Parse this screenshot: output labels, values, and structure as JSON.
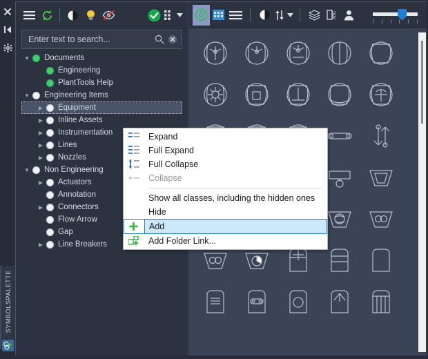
{
  "rail": {
    "icons": [
      {
        "name": "close-icon",
        "glyph": "✖"
      },
      {
        "name": "collapse-panel-icon",
        "glyph": "▶|"
      },
      {
        "name": "settings-gear-icon",
        "glyph": "✻"
      }
    ],
    "vertical_tab_label": "SYMBOLSPALETTE"
  },
  "tree_toolbar": {
    "buttons": [
      {
        "name": "menu-hamburger-icon",
        "label": "Menu"
      },
      {
        "name": "refresh-icon",
        "label": "Refresh"
      },
      {
        "name": "contrast-icon",
        "label": "Contrast"
      },
      {
        "name": "lightbulb-icon",
        "label": "Highlight"
      },
      {
        "name": "hidden-visibility-icon",
        "label": "Show hidden"
      },
      {
        "name": "check-circle-icon",
        "label": "Apply"
      },
      {
        "name": "grid-dots-icon",
        "label": "View options"
      },
      {
        "name": "dropdown-caret-icon",
        "label": "More"
      }
    ]
  },
  "search": {
    "placeholder": "Enter text to search...",
    "value": "",
    "search_icon": "search-icon",
    "clear_icon": "clear-icon"
  },
  "tree": {
    "items": [
      {
        "label": "Documents",
        "depth": 0,
        "twisty": "down",
        "dot": "green",
        "selected": false
      },
      {
        "label": "Engineering",
        "depth": 1,
        "twisty": "none",
        "dot": "green",
        "selected": false
      },
      {
        "label": "PlantTools Help",
        "depth": 1,
        "twisty": "none",
        "dot": "green",
        "selected": false
      },
      {
        "label": "Engineering Items",
        "depth": 0,
        "twisty": "down",
        "dot": "white",
        "selected": false
      },
      {
        "label": "Equipment",
        "depth": 1,
        "twisty": "right",
        "dot": "white",
        "selected": true
      },
      {
        "label": "Inline Assets",
        "depth": 1,
        "twisty": "right",
        "dot": "white",
        "selected": false
      },
      {
        "label": "Instrumentation",
        "depth": 1,
        "twisty": "right",
        "dot": "white",
        "selected": false
      },
      {
        "label": "Lines",
        "depth": 1,
        "twisty": "right",
        "dot": "white",
        "selected": false
      },
      {
        "label": "Nozzles",
        "depth": 1,
        "twisty": "right",
        "dot": "white",
        "selected": false
      },
      {
        "label": "Non Engineering",
        "depth": 0,
        "twisty": "down",
        "dot": "white",
        "selected": false
      },
      {
        "label": "Actuators",
        "depth": 1,
        "twisty": "right",
        "dot": "white",
        "selected": false
      },
      {
        "label": "Annotation",
        "depth": 1,
        "twisty": "none",
        "dot": "white",
        "selected": false
      },
      {
        "label": "Connectors",
        "depth": 1,
        "twisty": "right",
        "dot": "white",
        "selected": false
      },
      {
        "label": "Flow Arrow",
        "depth": 1,
        "twisty": "none",
        "dot": "white",
        "selected": false
      },
      {
        "label": "Gap",
        "depth": 1,
        "twisty": "none",
        "dot": "white",
        "selected": false
      },
      {
        "label": "Line Breakers",
        "depth": 1,
        "twisty": "right",
        "dot": "white",
        "selected": false
      }
    ]
  },
  "context_menu": {
    "items": [
      {
        "label": "Expand",
        "icon": "expand-icon",
        "state": "normal",
        "separator_after": false
      },
      {
        "label": "Full Expand",
        "icon": "full-expand-icon",
        "state": "normal",
        "separator_after": false
      },
      {
        "label": "Full Collapse",
        "icon": "full-collapse-icon",
        "state": "normal",
        "separator_after": false
      },
      {
        "label": "Collapse",
        "icon": "collapse-icon",
        "state": "disabled",
        "separator_after": true
      },
      {
        "label": "Show all classes, including the hidden ones",
        "icon": "none",
        "state": "normal",
        "separator_after": false
      },
      {
        "label": "Hide",
        "icon": "none",
        "state": "normal",
        "separator_after": false
      },
      {
        "label": "Add",
        "icon": "plus-icon",
        "state": "selected",
        "separator_after": false
      },
      {
        "label": "Add Folder Link...",
        "icon": "add-folder-link-icon",
        "state": "normal",
        "separator_after": false
      }
    ]
  },
  "symbol_toolbar": {
    "tabs": [
      {
        "name": "tab-symbols",
        "icon": "circle-leaf-icon",
        "active": true
      },
      {
        "name": "tab-grid",
        "icon": "grid-view-icon",
        "active": false
      },
      {
        "name": "tab-list",
        "icon": "list-view-icon",
        "active": false
      }
    ],
    "tools": [
      {
        "name": "contrast-icon",
        "icon": "contrast-icon"
      },
      {
        "name": "sort-icon",
        "icon": "sort-updown-icon"
      },
      {
        "name": "sort-caret-icon",
        "icon": "caret-down-icon"
      },
      {
        "name": "layers-icon",
        "icon": "layers-icon"
      },
      {
        "name": "label-abc-icon",
        "icon": "abc-label-icon"
      },
      {
        "name": "user-icon",
        "icon": "person-icon"
      }
    ],
    "zoom_slider": {
      "value": 55,
      "min": 0,
      "max": 100,
      "ticks": 6
    }
  },
  "symbol_grid": {
    "columns": 5,
    "symbols": [
      "agitator-propeller-1",
      "agitator-propeller-2",
      "agitator-propeller-3",
      "vessel-split",
      "vessel-plain",
      "agitator-radial",
      "vessel-square-internal",
      "vessel-tee-internal",
      "vessel-dish",
      "vessel-anchor",
      "vessel-a",
      "vessel-b",
      "vessel-c",
      "bar-capsule",
      "flow-s-arrows",
      "vessel-d",
      "vessel-e",
      "vessel-f",
      "plate-with-circle",
      "hopper-trapezoid",
      "hopper-x-1",
      "hopper-x-2",
      "hopper-circle-side",
      "hopper-globe",
      "hopper-double-circle",
      "hopper-double-circle-2",
      "hopper-pie",
      "tank-cross-top",
      "tank-banded",
      "tank-plain",
      "tank-lines",
      "tank-capsule",
      "tank-circle",
      "tank-fan",
      "tank-columns"
    ]
  }
}
